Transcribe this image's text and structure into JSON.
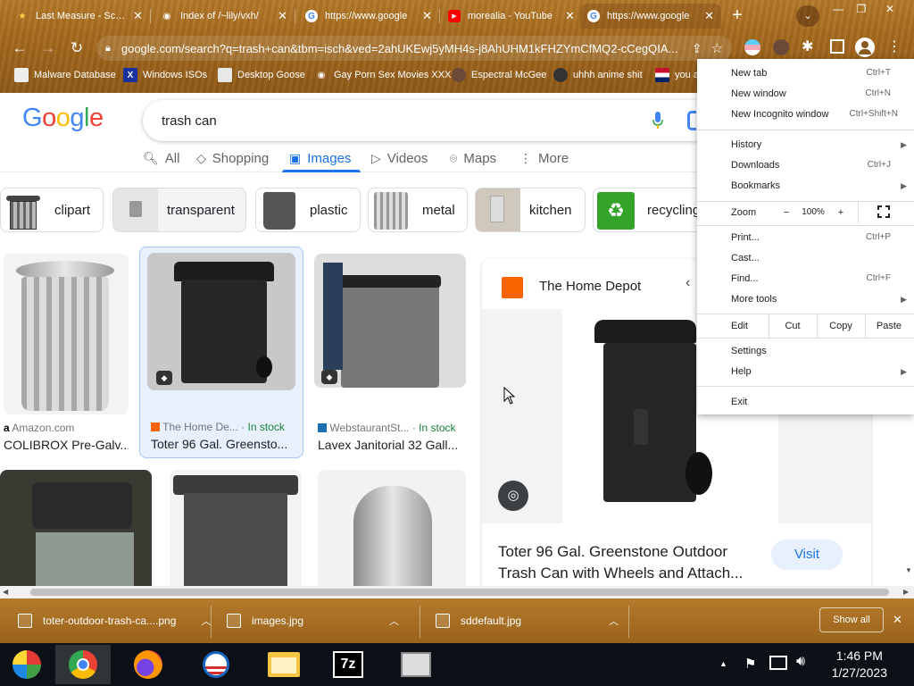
{
  "browser": {
    "tabs": [
      {
        "title": "Last Measure - Screa",
        "icon": "star-icon"
      },
      {
        "title": "Index of /~lily/vxh/",
        "icon": "globe-icon"
      },
      {
        "title": "https://www.google",
        "icon": "google-icon"
      },
      {
        "title": "morealia - YouTube",
        "icon": "youtube-icon"
      },
      {
        "title": "https://www.google",
        "icon": "google-icon"
      }
    ],
    "url": "google.com/search?q=trash+can&tbm=isch&ved=2ahUKEwj5yMH4s-j8AhUHM1kFHZYmCfMQ2-cCegQIA...",
    "bookmarks": [
      {
        "label": "Malware Database"
      },
      {
        "label": "Windows ISOs"
      },
      {
        "label": "Desktop Goose"
      },
      {
        "label": "Gay Porn Sex Movies XXX"
      },
      {
        "label": "Espectral McGee"
      },
      {
        "label": "uhhh anime shit"
      },
      {
        "label": "you a"
      }
    ]
  },
  "google": {
    "query": "trash can",
    "tabs": [
      {
        "label": "All"
      },
      {
        "label": "Shopping"
      },
      {
        "label": "Images"
      },
      {
        "label": "Videos"
      },
      {
        "label": "Maps"
      },
      {
        "label": "More"
      }
    ],
    "chips": [
      {
        "label": "clipart"
      },
      {
        "label": "transparent"
      },
      {
        "label": "plastic"
      },
      {
        "label": "metal"
      },
      {
        "label": "kitchen"
      },
      {
        "label": "recycling"
      }
    ],
    "results": [
      {
        "source": "Amazon.com",
        "name": "COLIBROX Pre-Galv...",
        "stock": ""
      },
      {
        "source": "The Home De...",
        "name": "Toter 96 Gal. Greensto...",
        "stock": "In stock"
      },
      {
        "source": "WebstaurantSt...",
        "name": "Lavex Janitorial 32 Gall...",
        "stock": "In stock"
      }
    ],
    "preview": {
      "store": "The Home Depot",
      "title": "Toter 96 Gal. Greenstone Outdoor Trash Can with Wheels and Attach...",
      "visit": "Visit"
    }
  },
  "menu": {
    "new_tab": "New tab",
    "new_tab_sc": "Ctrl+T",
    "new_window": "New window",
    "new_window_sc": "Ctrl+N",
    "incognito": "New Incognito window",
    "incognito_sc": "Ctrl+Shift+N",
    "history": "History",
    "downloads": "Downloads",
    "downloads_sc": "Ctrl+J",
    "bookmarks": "Bookmarks",
    "zoom": "Zoom",
    "zoom_minus": "−",
    "zoom_value": "100%",
    "zoom_plus": "+",
    "print": "Print...",
    "print_sc": "Ctrl+P",
    "cast": "Cast...",
    "find": "Find...",
    "find_sc": "Ctrl+F",
    "more_tools": "More tools",
    "edit": "Edit",
    "cut": "Cut",
    "copy": "Copy",
    "paste": "Paste",
    "settings": "Settings",
    "help": "Help",
    "exit": "Exit"
  },
  "downloads": {
    "items": [
      {
        "name": "toter-outdoor-trash-ca....png"
      },
      {
        "name": "images.jpg"
      },
      {
        "name": "sddefault.jpg"
      }
    ],
    "show_all": "Show all"
  },
  "taskbar": {
    "time": "1:46 PM",
    "date": "1/27/2023"
  }
}
